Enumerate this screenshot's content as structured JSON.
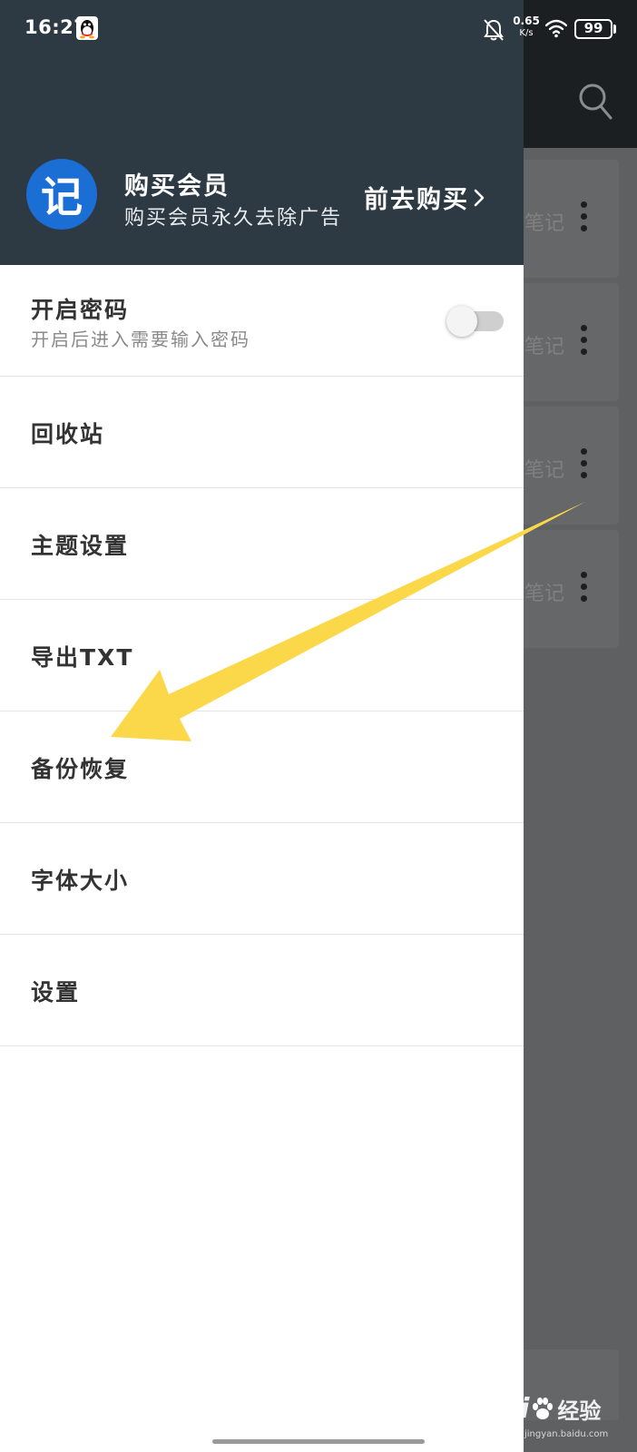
{
  "status_bar": {
    "time": "16:27",
    "net_speed_value": "0.65",
    "net_speed_unit": "K/s",
    "battery": "99",
    "battery_level_percent": 99,
    "icons": [
      "qq-icon",
      "bell-off-icon",
      "wifi-icon",
      "battery-icon"
    ]
  },
  "background": {
    "cards": [
      {
        "text": "笔记"
      },
      {
        "text": "笔记"
      },
      {
        "text": "笔记"
      },
      {
        "text": "笔记"
      }
    ]
  },
  "drawer": {
    "logo_char": "记",
    "vip": {
      "title": "购买会员",
      "subtitle": "购买会员永久去除广告",
      "link": "前去购买"
    },
    "menu": [
      {
        "label": "开启密码",
        "sub": "开启后进入需要输入密码",
        "toggle_on": false
      },
      {
        "label": "回收站"
      },
      {
        "label": "主题设置"
      },
      {
        "label": "导出TXT"
      },
      {
        "label": "备份恢复"
      },
      {
        "label": "字体大小"
      },
      {
        "label": "设置"
      }
    ]
  },
  "watermark": {
    "brand": "Bai",
    "text": "经验",
    "url": "jingyan.baidu.com"
  },
  "colors": {
    "drawer_header": "#2e3a43",
    "logo": "#1a6ed4",
    "arrow": "#fbd84a",
    "scrim": "#5f6061"
  }
}
